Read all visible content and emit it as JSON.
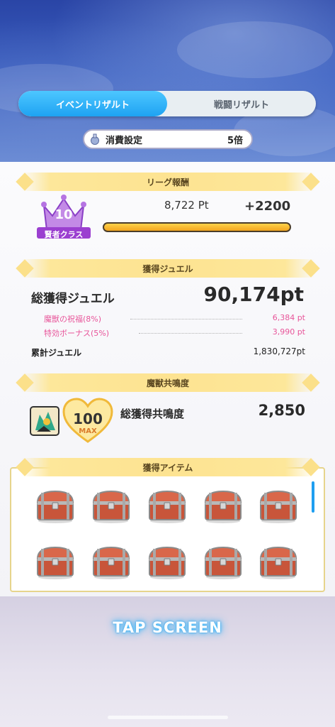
{
  "tabs": [
    {
      "label": "イベントリザルト",
      "active": true
    },
    {
      "label": "戦闘リザルト",
      "active": false
    }
  ],
  "consume": {
    "label": "消費設定",
    "value": "5倍"
  },
  "league": {
    "header": "リーグ報酬",
    "rank_number": "10",
    "rank_class": "賢者クラス",
    "points": "8,722 Pt",
    "gain": "+2200",
    "progress": 1.0
  },
  "jewel": {
    "header": "獲得ジュエル",
    "total_label": "総獲得ジュエル",
    "total_value": "90,174pt",
    "bonus1_label": "魔獣の祝福(8%)",
    "bonus1_value": "6,384 pt",
    "bonus2_label": "特効ボーナス(5%)",
    "bonus2_value": "3,990 pt",
    "cumulative_label": "累計ジュエル",
    "cumulative_value": "1,830,727pt"
  },
  "resonance": {
    "header": "魔獣共鳴度",
    "level": "100",
    "max": "MAX",
    "total_label": "総獲得共鳴度",
    "total_value": "2,850"
  },
  "items": {
    "header": "獲得アイテム",
    "list": [
      "treasure-chest-icon",
      "treasure-chest-icon",
      "treasure-chest-icon",
      "treasure-chest-icon",
      "treasure-chest-icon",
      "treasure-chest-icon",
      "treasure-chest-icon",
      "treasure-chest-icon",
      "treasure-chest-icon",
      "treasure-chest-icon"
    ]
  },
  "tap": "TAP SCREEN",
  "colors": {
    "accent": "#1ea3f2",
    "pink": "#e8559a",
    "gold": "#fde391",
    "purple": "#a24bd6"
  }
}
